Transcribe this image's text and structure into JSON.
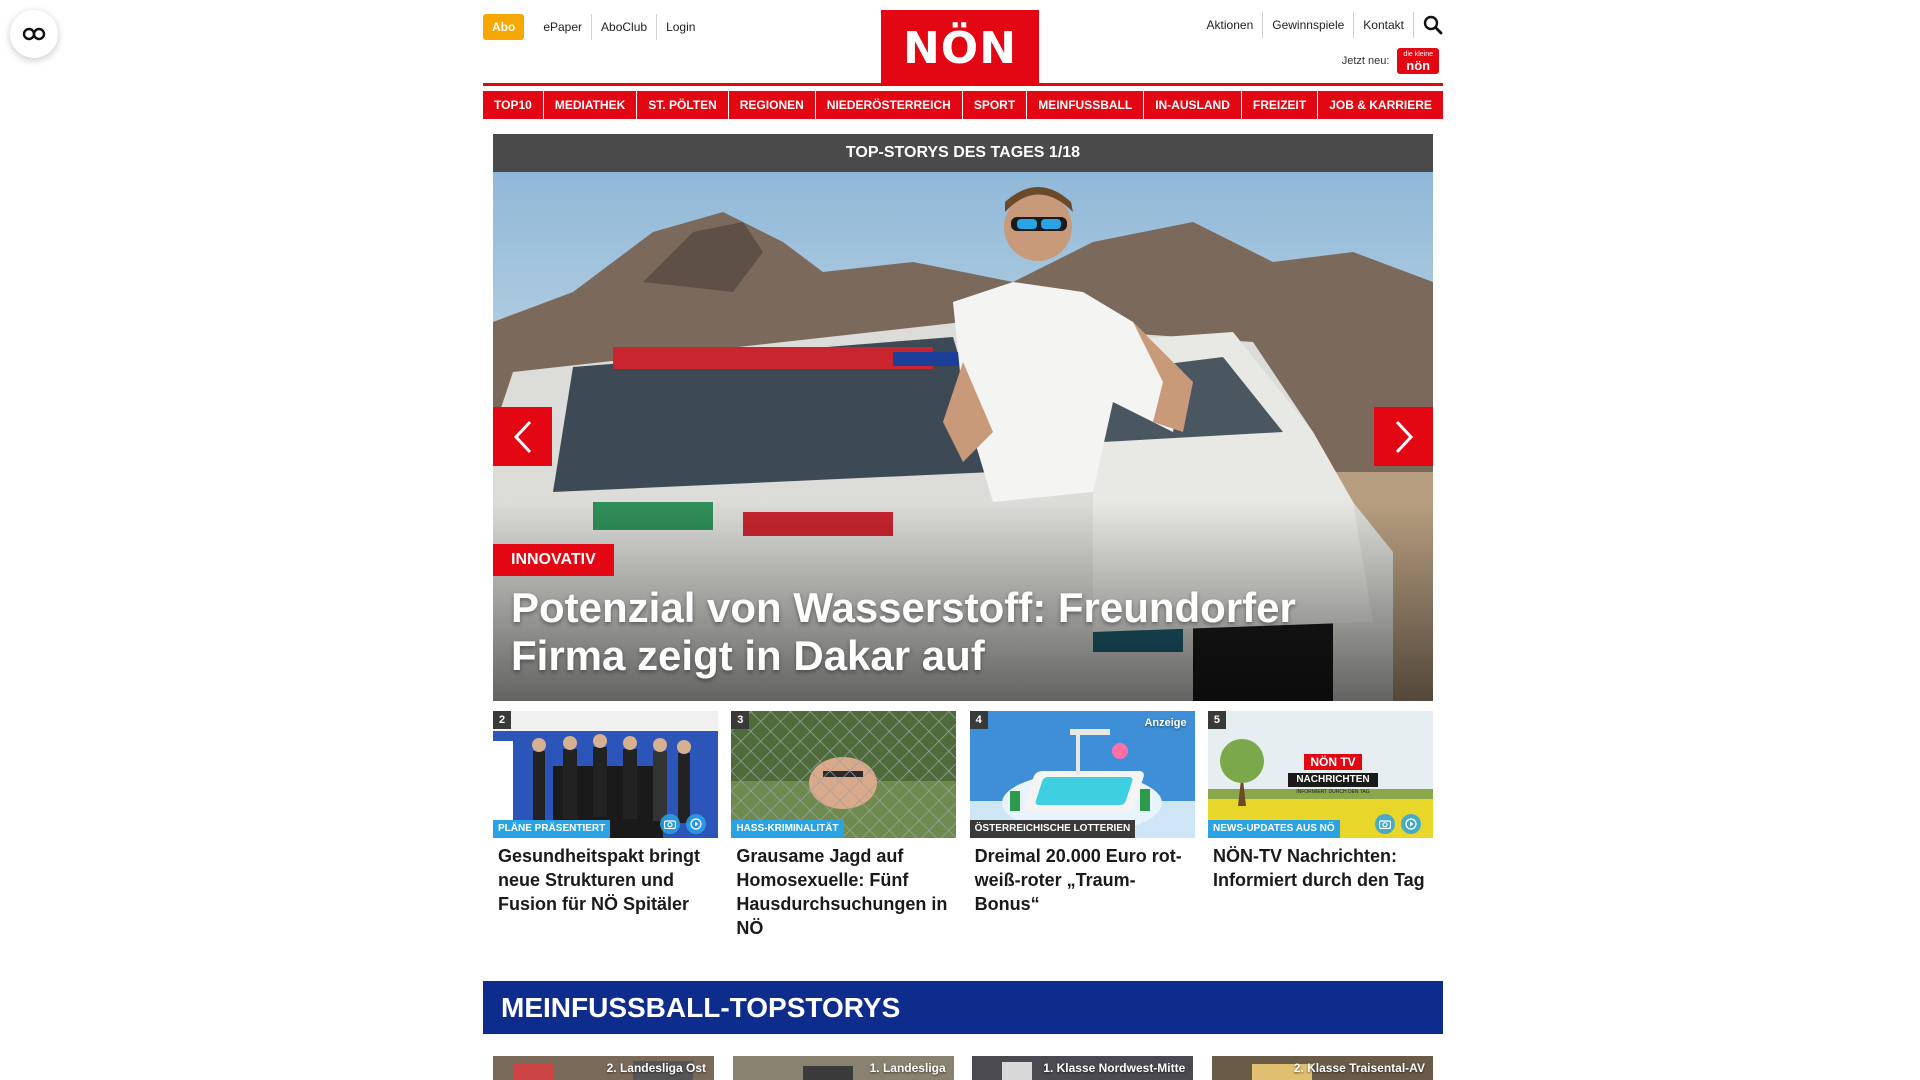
{
  "topnav": {
    "abo": "Abo",
    "left_links": [
      "ePaper",
      "AboClub",
      "Login"
    ],
    "right_links": [
      "Aktionen",
      "Gewinnspiele",
      "Kontakt"
    ],
    "jetzt_label": "Jetzt neu:",
    "jetzt_badge_small": "die kleine",
    "jetzt_badge": "nön"
  },
  "logo": "NÖN",
  "mainnav": [
    "TOP10",
    "MEDIATHEK",
    "ST. PÖLTEN",
    "REGIONEN",
    "NIEDERÖSTERREICH",
    "SPORT",
    "MEINFUSSBALL",
    "IN-AUSLAND",
    "FREIZEIT",
    "JOB & KARRIERE"
  ],
  "topstories": {
    "header": "TOP-STORYS DES TAGES 1/18",
    "hero_tag": "INNOVATIV",
    "hero_title": "Potenzial von Wasserstoff: Freundorfer Firma zeigt in Dakar auf"
  },
  "cards": [
    {
      "num": "2",
      "category": "PLÄNE PRÄSENTIERT",
      "title": "Gesundheitspakt bringt neue Strukturen und Fusion für NÖ Spitäler",
      "anzeige": ""
    },
    {
      "num": "3",
      "category": "HASS-KRIMINALITÄT",
      "title": "Grausame Jagd auf Homosexuelle: Fünf Hausdurchsuchungen in NÖ",
      "anzeige": ""
    },
    {
      "num": "4",
      "category": "ÖSTERREICHISCHE LOTTERIEN",
      "title": "Dreimal 20.000 Euro rot-weiß-roter „Traum-Bonus“",
      "anzeige": "Anzeige"
    },
    {
      "num": "5",
      "category": "NEWS-UPDATES AUS NÖ",
      "title": "NÖN-TV Nachrichten: Informiert durch den Tag",
      "anzeige": ""
    }
  ],
  "card5_overlay": {
    "brand": "NÖN TV",
    "line1": "NACHRICHTEN",
    "line2": "INFORMIERT DURCH DEN TAG"
  },
  "meinfussball": {
    "header": "MEINFUSSBALL-TOPSTORYS",
    "items": [
      "2. Landesliga Ost",
      "1. Landesliga",
      "1. Klasse Nordwest-Mitte",
      "2. Klasse Traisental-AV"
    ]
  },
  "colors": {
    "brand_red": "#e30613",
    "abo_orange": "#f7a800",
    "meinfussball_blue": "#0e2c8c",
    "category_blue": "#2aa3e4",
    "header_gray": "#4a4a4a"
  }
}
